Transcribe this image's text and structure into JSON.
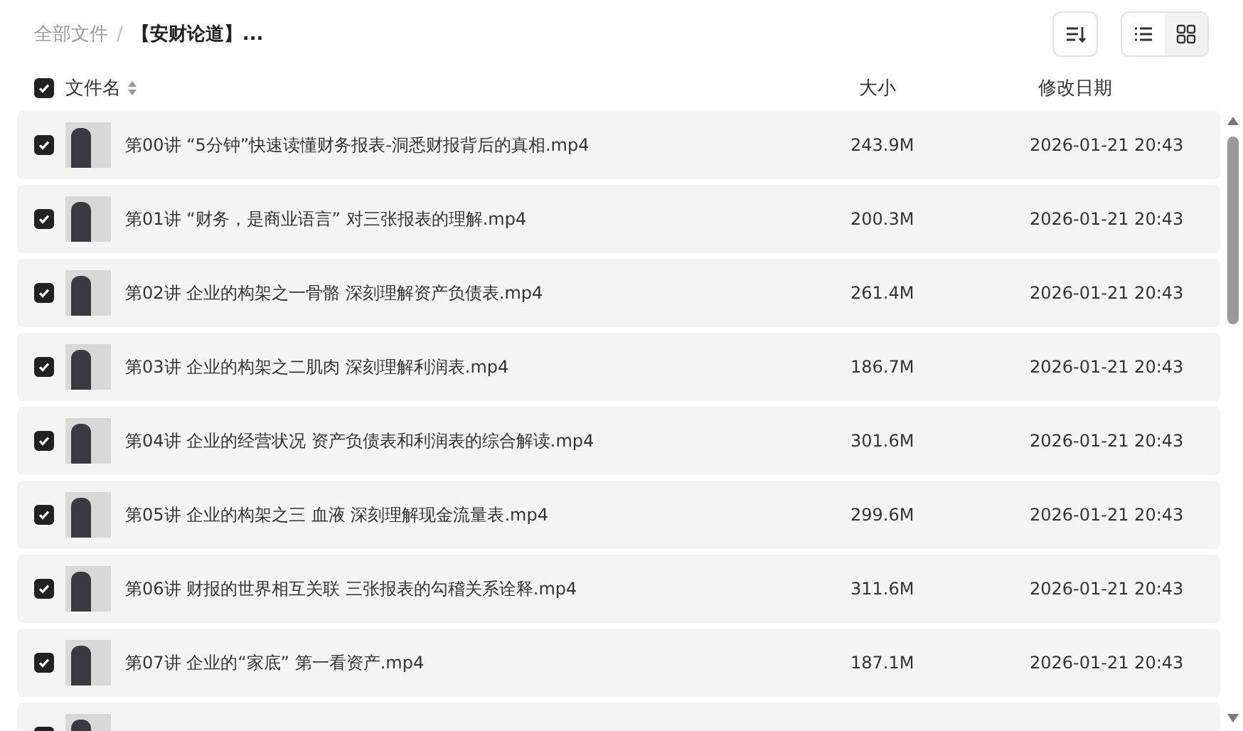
{
  "breadcrumb": [
    {
      "label": "全部文件",
      "current": false
    },
    {
      "label": "【安财论道】...",
      "current": true
    }
  ],
  "breadcrumb_separator": "/",
  "toolbar": {
    "view_modes": [
      {
        "kind": "list",
        "selected": true
      },
      {
        "kind": "grid",
        "selected": false
      }
    ]
  },
  "table": {
    "select_all": {
      "checked": true
    },
    "columns": [
      {
        "label": "文件名",
        "sortable": true
      },
      {
        "label": "大小",
        "sortable": false
      },
      {
        "label": "修改日期",
        "sortable": false
      }
    ],
    "rows": [
      {
        "checked": true,
        "name": "第00讲 “5分钟”快速读懂财务报表-洞悉财报背后的真相.mp4",
        "size": "243.9M",
        "date": "2026-01-21 20:43"
      },
      {
        "checked": true,
        "name": "第01讲 “财务，是商业语言” 对三张报表的理解.mp4",
        "size": "200.3M",
        "date": "2026-01-21 20:43"
      },
      {
        "checked": true,
        "name": "第02讲 企业的构架之一骨骼 深刻理解资产负债表.mp4",
        "size": "261.4M",
        "date": "2026-01-21 20:43"
      },
      {
        "checked": true,
        "name": "第03讲 企业的构架之二肌肉 深刻理解利润表.mp4",
        "size": "186.7M",
        "date": "2026-01-21 20:43"
      },
      {
        "checked": true,
        "name": "第04讲 企业的经营状况 资产负债表和利润表的综合解读.mp4",
        "size": "301.6M",
        "date": "2026-01-21 20:43"
      },
      {
        "checked": true,
        "name": "第05讲 企业的构架之三 血液 深刻理解现金流量表.mp4",
        "size": "299.6M",
        "date": "2026-01-21 20:43"
      },
      {
        "checked": true,
        "name": "第06讲 财报的世界相互关联 三张报表的勾稽关系诠释.mp4",
        "size": "311.6M",
        "date": "2026-01-21 20:43"
      },
      {
        "checked": true,
        "name": "第07讲 企业的“家底” 第一看资产.mp4",
        "size": "187.1M",
        "date": "2026-01-21 20:43"
      },
      {
        "checked": true
      }
    ]
  }
}
